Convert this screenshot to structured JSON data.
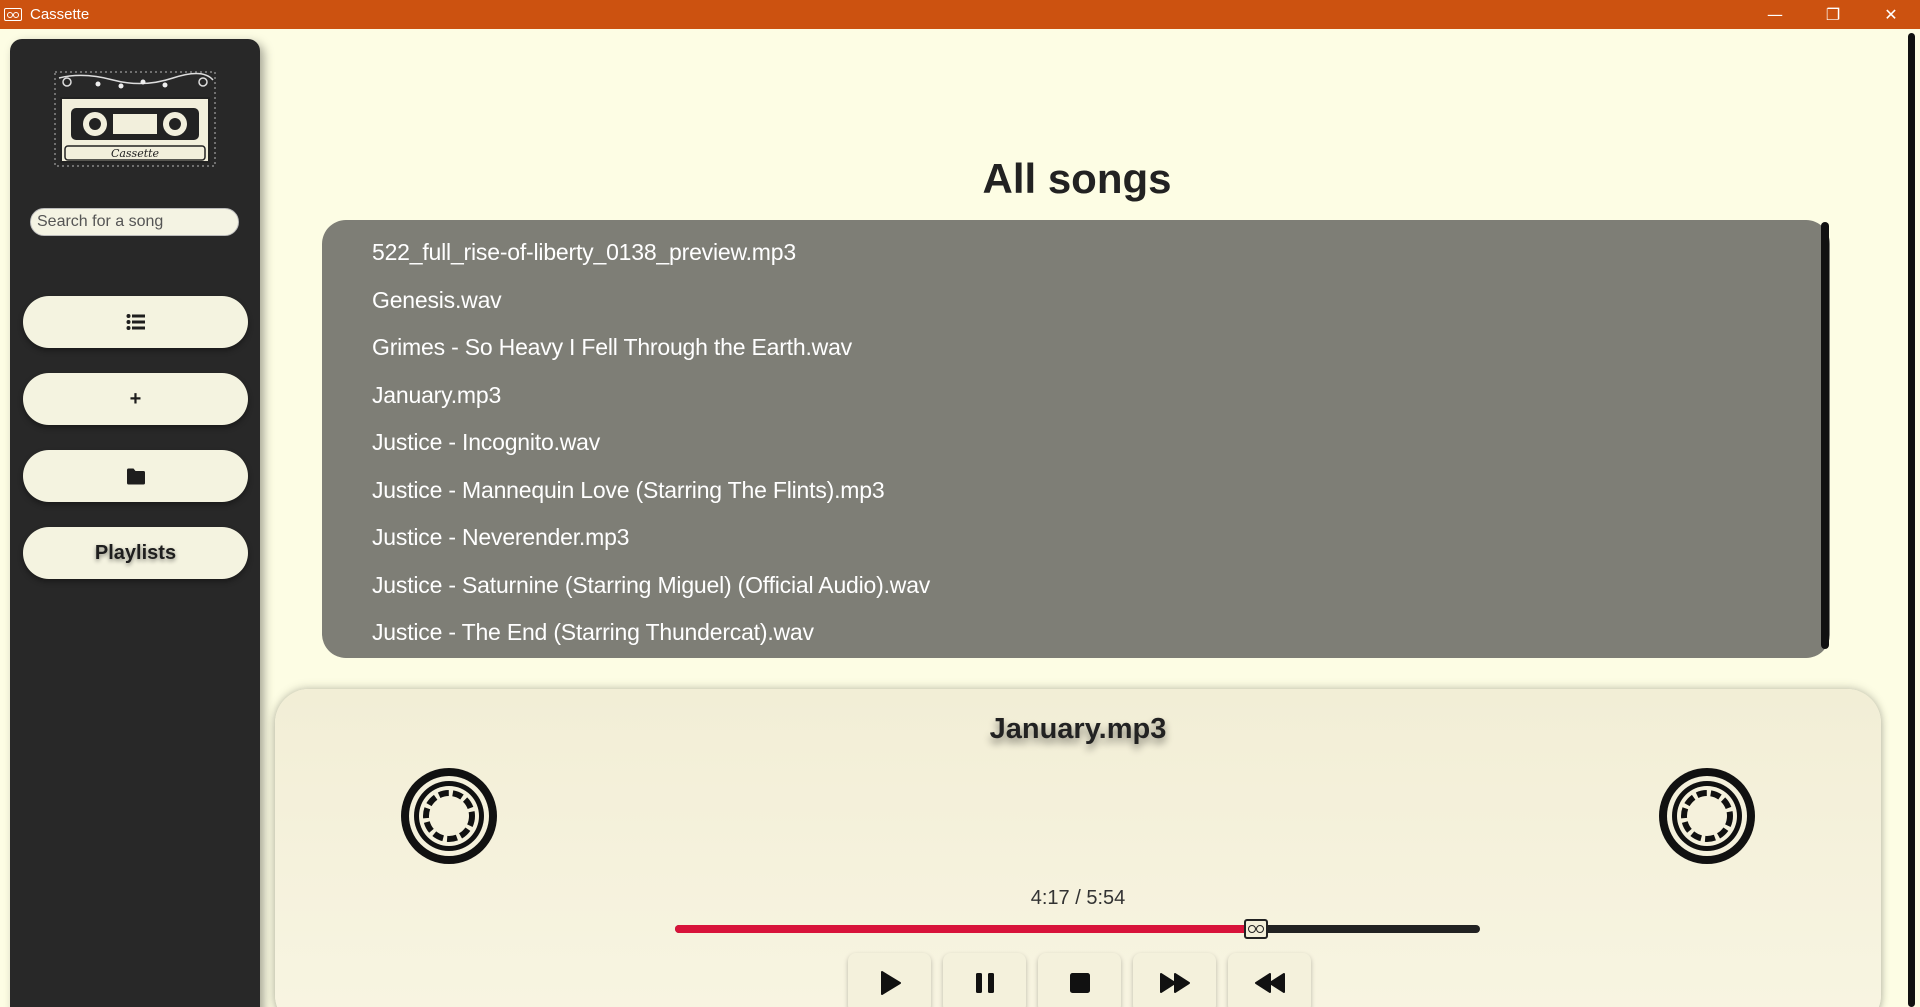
{
  "window": {
    "title": "Cassette",
    "controls": {
      "minimize": "—",
      "restore": "❐",
      "close": "✕"
    }
  },
  "sidebar": {
    "logo_text": "Cassette",
    "search_placeholder": "Search for a song",
    "buttons": {
      "all_songs_icon": "list-icon",
      "add_icon": "plus-icon",
      "add_label": "+",
      "folder_icon": "folder-icon",
      "playlists_label": "Playlists"
    }
  },
  "main": {
    "heading": "All songs",
    "songs": [
      "522_full_rise-of-liberty_0138_preview.mp3",
      "Genesis.wav",
      "Grimes - So Heavy I Fell Through the Earth.wav",
      "January.mp3",
      "Justice - Incognito.wav",
      "Justice - Mannequin Love (Starring The Flints).mp3",
      "Justice - Neverender.mp3",
      "Justice - Saturnine (Starring Miguel) (Official Audio).wav",
      "Justice - The End (Starring Thundercat).wav"
    ]
  },
  "player": {
    "now_playing": "January.mp3",
    "time_display": "4:17 / 5:54",
    "progress_fraction": 0.722,
    "controls": [
      "play-icon",
      "pause-icon",
      "stop-icon",
      "fast-forward-icon",
      "rewind-icon"
    ]
  },
  "colors": {
    "titlebar": "#cc5210",
    "sidebar": "#282828",
    "background": "#fdfde4",
    "list": "#7e7e76",
    "progress_fill": "#d8133a"
  }
}
